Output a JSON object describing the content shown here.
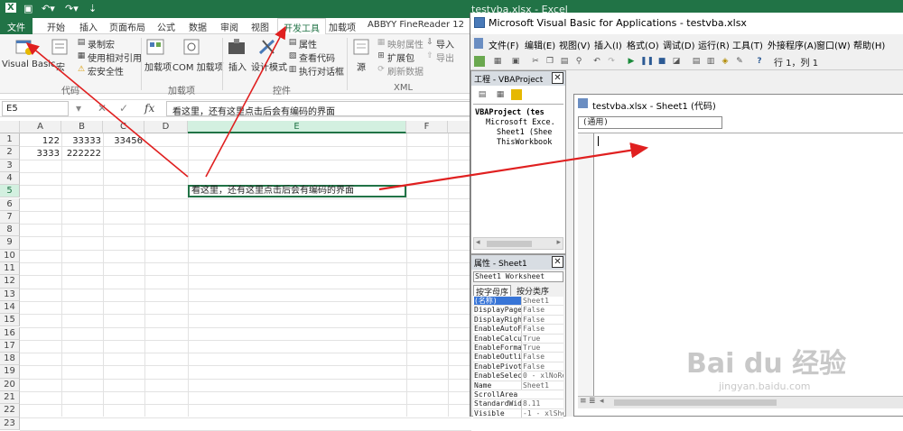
{
  "excel": {
    "window_title": "testvba.xlsx - Excel",
    "ribbon_tabs": [
      "文件",
      "开始",
      "插入",
      "页面布局",
      "公式",
      "数据",
      "审阅",
      "视图",
      "开发工具",
      "加载项",
      "ABBYY FineReader 12"
    ],
    "active_tab": "开发工具",
    "ribbon": {
      "visual_basic": "Visual Basic",
      "macros": "宏",
      "record_macro": "录制宏",
      "relative_ref": "使用相对引用",
      "macro_security": "宏安全性",
      "group_code": "代码",
      "addins": "加载项",
      "com_addins": "COM 加载项",
      "group_addins": "加载项",
      "insert": "插入",
      "design_mode": "设计模式",
      "properties": "属性",
      "view_code": "查看代码",
      "run_dialog": "执行对话框",
      "group_controls": "控件",
      "source": "源",
      "map_props": "映射属性",
      "expansion": "扩展包",
      "refresh_data": "刷新数据",
      "import": "导入",
      "export": "导出",
      "group_xml": "XML"
    },
    "name_box": "E5",
    "formula_bar_fx": "fx",
    "formula_value": "看这里，还有这里点击后会有编码的界面",
    "columns": [
      "A",
      "B",
      "C",
      "D",
      "E",
      "F"
    ],
    "rows": [
      "1",
      "2",
      "3",
      "4",
      "5",
      "6",
      "7",
      "8",
      "9",
      "10",
      "11",
      "12",
      "13",
      "14",
      "15",
      "16",
      "17",
      "18",
      "19",
      "20",
      "21",
      "22",
      "23"
    ],
    "cells": {
      "A1": "122",
      "B1": "33333",
      "C1": "33456",
      "A2": "3333",
      "B2": "222222"
    },
    "active_cell_text": "看这里，还有这里点击后会有编码的界面"
  },
  "vba": {
    "window_title": "Microsoft Visual Basic for Applications - testvba.xlsx",
    "menu": [
      "文件(F)",
      "编辑(E)",
      "视图(V)",
      "插入(I)",
      "格式(O)",
      "调试(D)",
      "运行(R)",
      "工具(T)",
      "外接程序(A)",
      "窗口(W)",
      "帮助(H)"
    ],
    "cursor_pos": "行 1，列 1",
    "project_pane_title": "工程 - VBAProject",
    "tree": [
      "VBAProject (tes",
      "Microsoft Exce.",
      "Sheet1 (Shee",
      "ThisWorkbook"
    ],
    "props_pane_title": "属性 - Sheet1",
    "props_object": "Sheet1 Worksheet",
    "props_tabs": [
      "按字母序",
      "按分类序"
    ],
    "props": [
      {
        "k": "(名称)",
        "v": "Sheet1"
      },
      {
        "k": "DisplayPage",
        "v": "False"
      },
      {
        "k": "DisplayRigh",
        "v": "False"
      },
      {
        "k": "EnableAutoF",
        "v": "False"
      },
      {
        "k": "EnableCalcu",
        "v": "True"
      },
      {
        "k": "EnableForma",
        "v": "True"
      },
      {
        "k": "EnableOutli",
        "v": "False"
      },
      {
        "k": "EnablePivot",
        "v": "False"
      },
      {
        "k": "EnableSelec",
        "v": "0 - xlNoRe"
      },
      {
        "k": "Name",
        "v": "Sheet1"
      },
      {
        "k": "ScrollArea",
        "v": ""
      },
      {
        "k": "StandardWid",
        "v": "8.11"
      },
      {
        "k": "Visible",
        "v": "-1 - xlShe"
      }
    ],
    "code_window_title": "testvba.xlsx - Sheet1 (代码)",
    "code_combo": "(通用)"
  },
  "watermark": {
    "brand": "Bai du 经验",
    "url": "jingyan.baidu.com"
  },
  "colors": {
    "excel_green": "#217346",
    "arrow_red": "#e02020"
  }
}
